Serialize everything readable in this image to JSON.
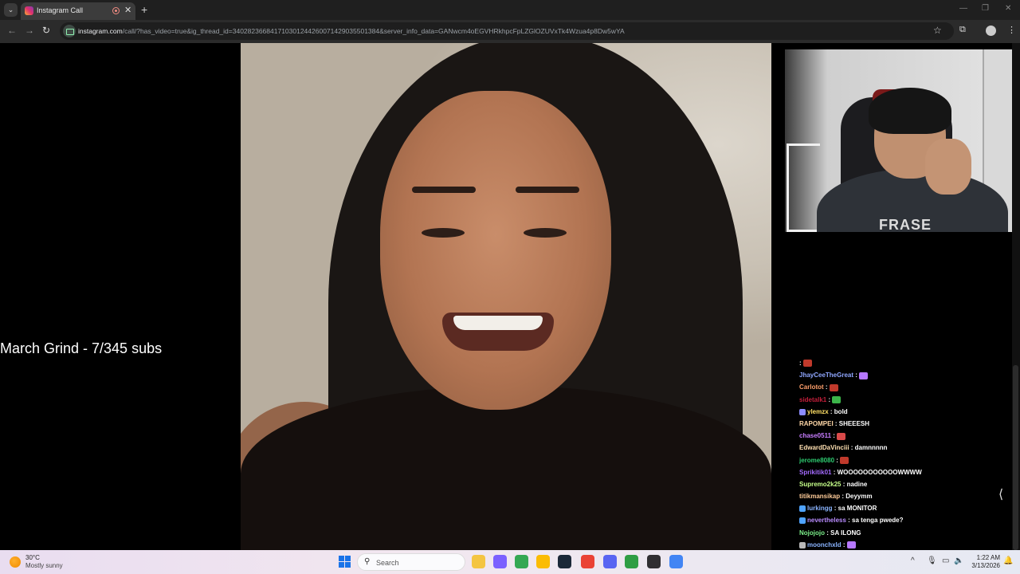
{
  "browser": {
    "tab_title": "Instagram Call",
    "url_host": "instagram.com",
    "url_path": "/call/?has_video=true&ig_thread_id=340282366841710301244260071429035501384&server_info_data=GANwcm4oEGVHRkhpcFpLZGlOZUVxTk4Wzua4p8Dw5wYA",
    "icons": {
      "tab_menu": "chevron-down-icon",
      "back": "arrow-left-icon",
      "forward": "arrow-right-icon",
      "reload": "reload-icon",
      "bookmark": "star-icon",
      "extensions": "puzzle-icon",
      "menu": "kebab-icon"
    }
  },
  "stream": {
    "overlay_text": "March Grind - 7/345 subs",
    "webcam_shirt_text": "FRASE"
  },
  "chat": {
    "messages": [
      {
        "user": "",
        "text": "",
        "color": "#ffffff",
        "emote": "#c0392b"
      },
      {
        "user": "JhayCeeTheGreat",
        "text": "",
        "color": "#8fa6ff",
        "emote": "#b678ff"
      },
      {
        "user": "Carlotot",
        "text": "",
        "color": "#ff9f6b",
        "emote": "#c0392b"
      },
      {
        "user": "sidetalk1",
        "text": "",
        "color": "#c41e3a",
        "emote": "#3cb54a"
      },
      {
        "user": "ylemzx",
        "text": "bold",
        "color": "#ffe066",
        "badge": "#8c8cff"
      },
      {
        "user": "RAPOMPEI",
        "text": "SHEEESH",
        "color": "#ffd8a8",
        "emote": ""
      },
      {
        "user": "chase0511",
        "text": "",
        "color": "#c77dff",
        "emote": "#d94a4a"
      },
      {
        "user": "EdwardDaVinciii",
        "text": "damnnnnn",
        "color": "#ffe0b2",
        "emote": ""
      },
      {
        "user": "jerome8080",
        "text": "",
        "color": "#2ecc71",
        "emote": "#c0392b"
      },
      {
        "user": "Sprikitik01",
        "text": "WOOOOOOOOOOOWWWW",
        "color": "#a46bff",
        "emote": ""
      },
      {
        "user": "Supremo2k25",
        "text": "nadine",
        "color": "#c6ff8a",
        "emote": ""
      },
      {
        "user": "titikmansikap",
        "text": "Deyymm",
        "color": "#ffcc99",
        "emote": ""
      },
      {
        "user": "lurkingg",
        "text": "sa MONITOR",
        "color": "#8ab4ff",
        "badge": "#4fa3ff"
      },
      {
        "user": "nevertheless",
        "text": "sa tenga pwede?",
        "color": "#b98cff",
        "badge": "#4fa3ff"
      },
      {
        "user": "Nojojojo",
        "text": "SA ILONG",
        "color": "#7cf08a",
        "emote": ""
      },
      {
        "user": "moonchxld",
        "text": "",
        "color": "#8ab4ff",
        "emote": "#b678ff",
        "badge": "#b9b9b9"
      }
    ]
  },
  "taskbar": {
    "weather_temp": "30°C",
    "weather_desc": "Mostly sunny",
    "search_label": "Search",
    "time": "1:22 AM",
    "date": "3/13/2026",
    "apps": [
      {
        "name": "file-explorer-icon",
        "color": "#f4c542"
      },
      {
        "name": "copilot-icon",
        "color": "#7b61ff"
      },
      {
        "name": "chrome-icon-1",
        "color": "#34a853"
      },
      {
        "name": "chrome-icon-2",
        "color": "#fbbc05"
      },
      {
        "name": "steam-icon",
        "color": "#1b2838"
      },
      {
        "name": "chrome-icon-3",
        "color": "#ea4335"
      },
      {
        "name": "discord-icon",
        "color": "#5865f2"
      },
      {
        "name": "terminal-icon",
        "color": "#2f9e44"
      },
      {
        "name": "obs-icon",
        "color": "#302e31"
      },
      {
        "name": "chrome-icon-4",
        "color": "#4285f4"
      }
    ]
  }
}
